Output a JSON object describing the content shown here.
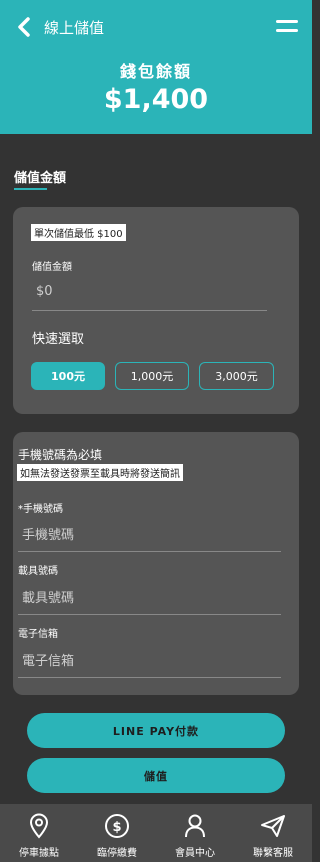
{
  "header": {
    "title": "線上儲值",
    "wallet_label": "錢包餘額",
    "wallet_amount": "$1,400"
  },
  "section": {
    "title": "儲值金額"
  },
  "topup": {
    "min_note": "單次儲值最低 $100",
    "amount_label": "儲值金額",
    "amount_placeholder": "$0",
    "quick_label": "快速選取",
    "quick_options": [
      "100元",
      "1,000元",
      "3,000元"
    ]
  },
  "contact": {
    "title": "手機號碼為必填",
    "note": "如無法發送發票至載具時將發送簡訊",
    "phone_label": "*手機號碼",
    "phone_placeholder": "手機號碼",
    "carrier_label": "載具號碼",
    "carrier_placeholder": "載具號碼",
    "email_label": "電子信箱",
    "email_placeholder": "電子信箱"
  },
  "actions": {
    "linepay": "LINE PAY付款",
    "topup": "儲值"
  },
  "nav": [
    {
      "label": "停車據點",
      "icon": "location-pin-icon"
    },
    {
      "label": "臨停繳費",
      "icon": "dollar-circle-icon"
    },
    {
      "label": "會員中心",
      "icon": "user-icon"
    },
    {
      "label": "聯繫客服",
      "icon": "paper-plane-icon"
    }
  ],
  "colors": {
    "accent": "#2bb4b8",
    "background": "#333333",
    "card": "#555555"
  }
}
